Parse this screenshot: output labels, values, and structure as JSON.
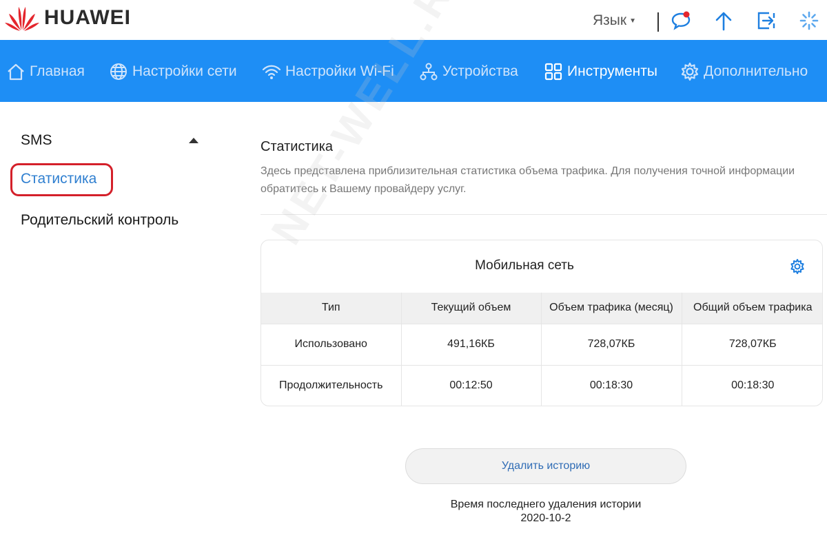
{
  "header": {
    "brand": "HUAWEI",
    "language_label": "Язык",
    "brand_color": "#e4262d",
    "icons": [
      "message-icon",
      "upload-icon",
      "logout-icon",
      "loading-icon"
    ]
  },
  "nav": {
    "bg_color": "#1e8ef5",
    "items": [
      {
        "label": "Главная",
        "icon": "home-icon",
        "active": false
      },
      {
        "label": "Настройки сети",
        "icon": "globe-icon",
        "active": false
      },
      {
        "label": "Настройки Wi-Fi",
        "icon": "wifi-icon",
        "active": false
      },
      {
        "label": "Устройства",
        "icon": "devices-icon",
        "active": false
      },
      {
        "label": "Инструменты",
        "icon": "tools-icon",
        "active": true
      },
      {
        "label": "Дополнительно",
        "icon": "gear-icon",
        "active": false
      }
    ]
  },
  "sidebar": {
    "group_label": "SMS",
    "active_item": "Статистика",
    "items": [
      "Родительский контроль"
    ]
  },
  "main": {
    "title": "Статистика",
    "description": "Здесь представлена приблизительная статистика объема трафика. Для получения точной информации обратитесь к Вашему провайдеру услуг.",
    "card": {
      "title": "Мобильная сеть",
      "columns": [
        "Тип",
        "Текущий объем",
        "Объем трафика (месяц)",
        "Общий объем трафика"
      ],
      "rows": [
        [
          "Использовано",
          "491,16КБ",
          "728,07КБ",
          "728,07КБ"
        ],
        [
          "Продолжительность",
          "00:12:50",
          "00:18:30",
          "00:18:30"
        ]
      ]
    },
    "delete_button": "Удалить историю",
    "last_delete_label": "Время последнего удаления истории",
    "last_delete_date": "2020-10-2"
  },
  "watermark": "NET-WELL.RU"
}
